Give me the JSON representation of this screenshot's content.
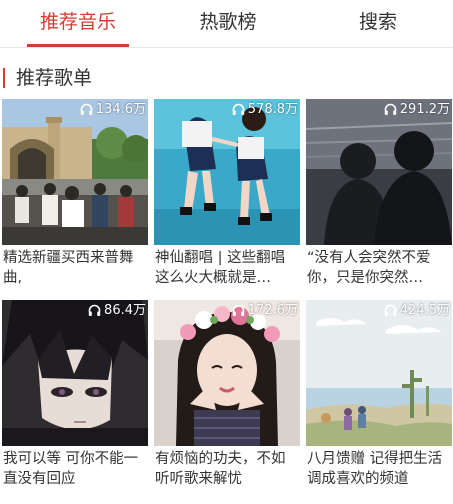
{
  "tabs": [
    {
      "label": "推荐音乐",
      "active": true
    },
    {
      "label": "热歌榜",
      "active": false
    },
    {
      "label": "搜索",
      "active": false
    }
  ],
  "accent_color": "#d43c33",
  "section": {
    "title": "推荐歌单"
  },
  "playlists": [
    {
      "play_count": "134.6万",
      "name": "精选新疆买西来普舞曲,"
    },
    {
      "play_count": "578.8万",
      "name": "神仙翻唱 | 这些翻唱这么火大概就是…"
    },
    {
      "play_count": "291.2万",
      "name": "“没有人会突然不爱你，只是你突然…"
    },
    {
      "play_count": "86.4万",
      "name": "我可以等 可你不能一直没有回应"
    },
    {
      "play_count": "172.6万",
      "name": "有烦恼的功夫，不如听听歌来解忧"
    },
    {
      "play_count": "424.5万",
      "name": "八月馈赠 记得把生活调成喜欢的频道"
    }
  ],
  "icons": {
    "play_count": "headphones-icon"
  }
}
